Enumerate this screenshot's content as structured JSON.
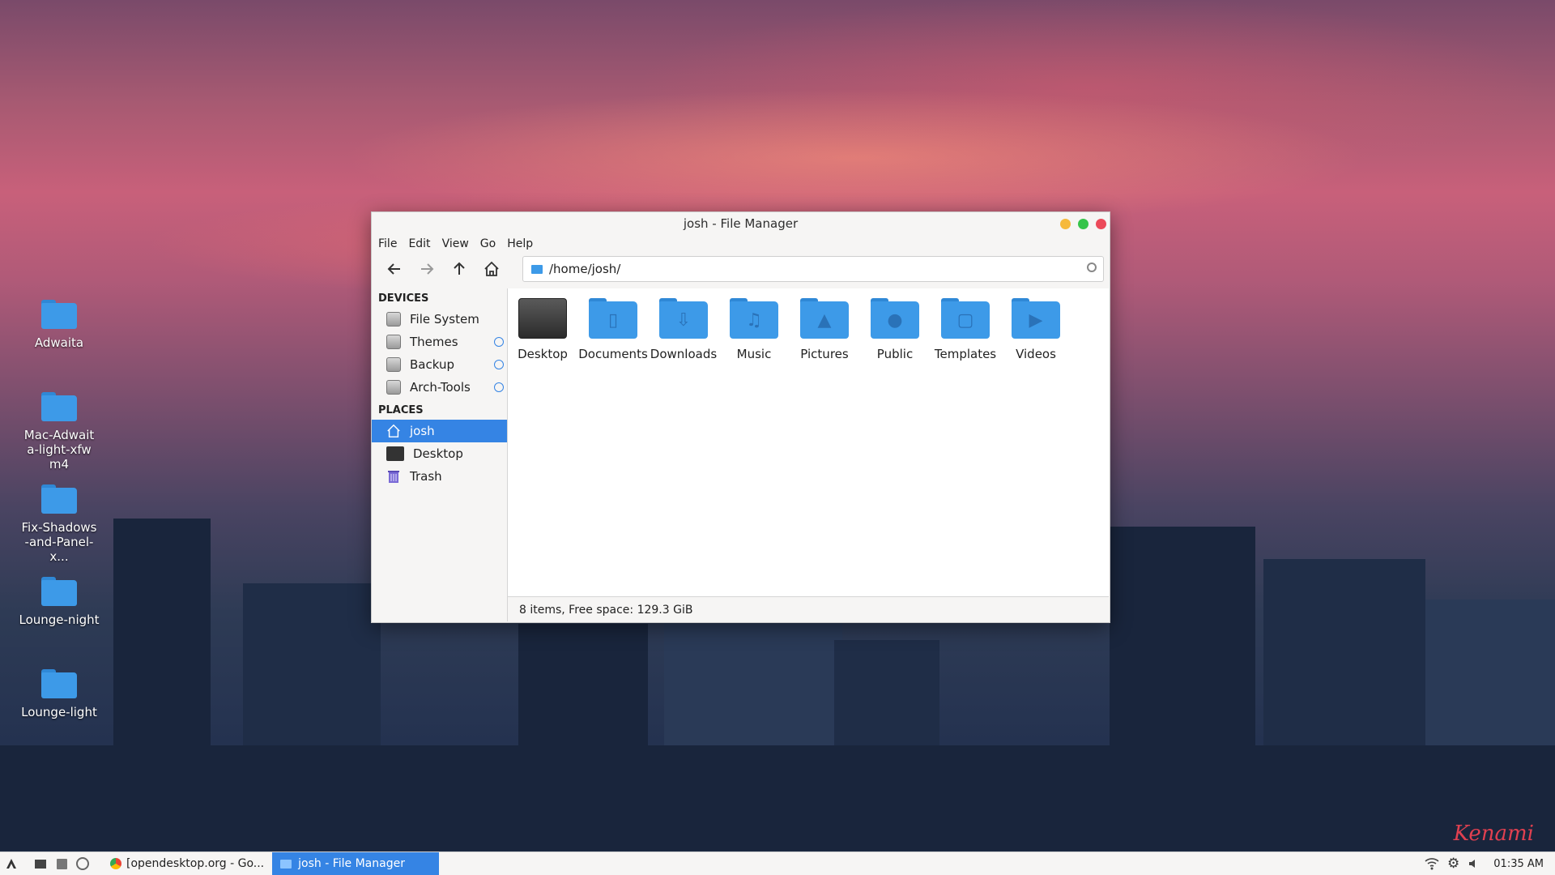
{
  "desktop": {
    "icons": [
      {
        "label": "Adwaita"
      },
      {
        "label": "Mac-Adwaita-light-xfwm4"
      },
      {
        "label": "Fix-Shadows-and-Panel-x..."
      },
      {
        "label": "Lounge-night"
      },
      {
        "label": "Lounge-light"
      }
    ],
    "watermark": "Kenami"
  },
  "window": {
    "title": "josh - File Manager",
    "menu": [
      "File",
      "Edit",
      "View",
      "Go",
      "Help"
    ],
    "path": "/home/josh/",
    "sidebar": {
      "devices_header": "DEVICES",
      "devices": [
        {
          "label": "File System",
          "ejectable": false
        },
        {
          "label": "Themes",
          "ejectable": true
        },
        {
          "label": "Backup",
          "ejectable": true
        },
        {
          "label": "Arch-Tools",
          "ejectable": true
        }
      ],
      "places_header": "PLACES",
      "places": [
        {
          "label": "josh",
          "icon": "home-icon",
          "selected": true
        },
        {
          "label": "Desktop",
          "icon": "desktop-icon",
          "selected": false
        },
        {
          "label": "Trash",
          "icon": "trash-icon",
          "selected": false
        }
      ]
    },
    "files": [
      {
        "label": "Desktop",
        "icon": "desktop-folder-icon"
      },
      {
        "label": "Documents",
        "icon": "documents-folder-icon"
      },
      {
        "label": "Downloads",
        "icon": "downloads-folder-icon"
      },
      {
        "label": "Music",
        "icon": "music-folder-icon"
      },
      {
        "label": "Pictures",
        "icon": "pictures-folder-icon"
      },
      {
        "label": "Public",
        "icon": "public-folder-icon"
      },
      {
        "label": "Templates",
        "icon": "templates-folder-icon"
      },
      {
        "label": "Videos",
        "icon": "videos-folder-icon"
      }
    ],
    "status": "8 items, Free space: 129.3 GiB"
  },
  "taskbar": {
    "tasks": [
      {
        "label": "[opendesktop.org - Go...",
        "active": false
      },
      {
        "label": "josh - File Manager",
        "active": true
      }
    ],
    "clock": "01:35 AM"
  },
  "colors": {
    "accent": "#3584e4",
    "folder": "#3d9ae8",
    "close": "#ec4a5a",
    "minimize": "#f6b93b",
    "maximize": "#36c44a"
  }
}
